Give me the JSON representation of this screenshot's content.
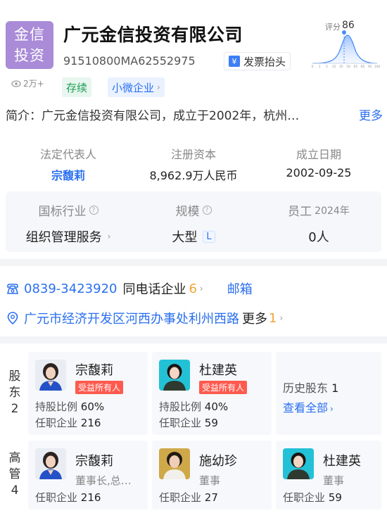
{
  "company": {
    "logo_text_line1": "金信",
    "logo_text_line2": "投资",
    "name": "广元金信投资有限公司",
    "credit_code": "91510800MA62552975",
    "invoice_label": "发票抬头",
    "invoice_icon_glyph": "¥",
    "score_label": "评分",
    "score_value": "86",
    "score_axis_ticks": [
      "0",
      "1",
      "5",
      "15",
      "35",
      "50",
      "65",
      "85",
      "95",
      "100"
    ],
    "views": "2万+",
    "tags": [
      "存续",
      "小微企业"
    ],
    "intro_label": "简介：",
    "intro_text": "广元金信投资有限公司，成立于2002年，杭州…",
    "intro_more": "更多"
  },
  "info": {
    "legal_rep_label": "法定代表人",
    "legal_rep_value": "宗馥莉",
    "capital_label": "注册资本",
    "capital_value": "8,962.9万人民币",
    "founded_label": "成立日期",
    "founded_value": "2002-09-25",
    "industry_label": "国标行业",
    "industry_value": "组织管理服务",
    "scale_label": "规模",
    "scale_value": "大型",
    "scale_badge": "L",
    "staff_label": "员工",
    "staff_year": "2024年",
    "staff_value": "0人"
  },
  "contact": {
    "phone": "0839-3423920",
    "same_phone_label": "同电话企业",
    "same_phone_count": "6",
    "email_label": "邮箱",
    "address": "广元市经济开发区河西办事处利州西路",
    "address_more": "更多",
    "address_more_count": "1"
  },
  "shareholders": {
    "side_label": [
      "股",
      "东",
      "2"
    ],
    "people": [
      {
        "name": "宗馥莉",
        "badge": "受益所有人",
        "ratio_label": "持股比例",
        "ratio": "60%",
        "jobs_label": "任职企业",
        "jobs": "216"
      },
      {
        "name": "杜建英",
        "badge": "受益所有人",
        "ratio_label": "持股比例",
        "ratio": "40%",
        "jobs_label": "任职企业",
        "jobs": "59"
      }
    ],
    "history_label": "历史股东",
    "history_count": "1",
    "view_all": "查看全部"
  },
  "executives": {
    "side_label": [
      "高",
      "管",
      "4"
    ],
    "people": [
      {
        "name": "宗馥莉",
        "role": "董事长,总…",
        "jobs_label": "任职企业",
        "jobs": "216"
      },
      {
        "name": "施幼珍",
        "role": "董事",
        "jobs_label": "任职企业",
        "jobs": "27"
      },
      {
        "name": "杜建英",
        "role": "董事",
        "jobs_label": "任职企业",
        "jobs": "59"
      }
    ]
  },
  "colors": {
    "accent": "#2a6ff0",
    "logo_bg": "#a98bd8",
    "badge_red": "#ff5a4f",
    "count_orange": "#f2a33a",
    "tag_green": "#1f9d55"
  }
}
